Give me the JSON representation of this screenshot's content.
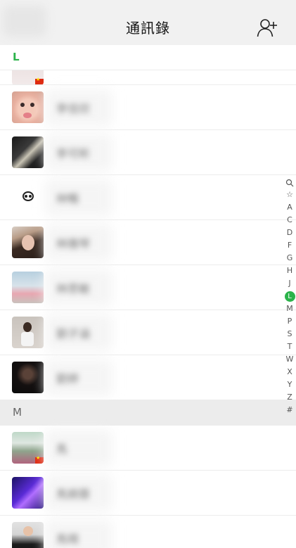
{
  "header": {
    "title": "通訊錄"
  },
  "sections": [
    {
      "letter": "L",
      "rows": [
        {
          "avatar": "av-partial"
        },
        {
          "avatar": "av-1",
          "name": "李佳欣"
        },
        {
          "avatar": "av-2",
          "name": "李可昕"
        },
        {
          "avatar": "av-3",
          "name": "林暢"
        },
        {
          "avatar": "av-4",
          "name": "林雅琴"
        },
        {
          "avatar": "av-5",
          "name": "林思敏"
        },
        {
          "avatar": "av-6",
          "name": "劉子涵"
        },
        {
          "avatar": "av-7",
          "name": "劉婷"
        }
      ]
    },
    {
      "letter": "M",
      "rows": [
        {
          "avatar": "av-8",
          "name": "馬"
        },
        {
          "avatar": "av-9",
          "name": "馬婉蓉"
        },
        {
          "avatar": "av-10",
          "name": "馬晴"
        }
      ]
    }
  ],
  "index": {
    "search_icon": "search-icon",
    "star": "☆",
    "letters": [
      "A",
      "C",
      "D",
      "F",
      "G",
      "H",
      "J",
      "L",
      "M",
      "P",
      "S",
      "T",
      "W",
      "X",
      "Y",
      "Z",
      "#"
    ],
    "active": "L"
  },
  "colors": {
    "accent": "#2bb34a",
    "header_bg": "#f1f1f1",
    "section_bg": "#ececec"
  }
}
